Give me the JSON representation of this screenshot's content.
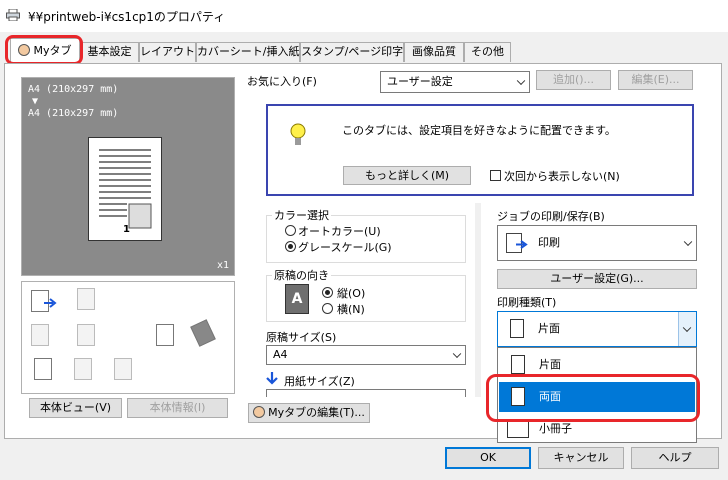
{
  "window": {
    "title": "¥¥printweb-i¥cs1cp1のプロパティ"
  },
  "tabs": [
    {
      "label": "Myタブ",
      "active": true
    },
    {
      "label": "基本設定"
    },
    {
      "label": "レイアウト"
    },
    {
      "label": "カバーシート/挿入紙"
    },
    {
      "label": "スタンプ/ページ印字"
    },
    {
      "label": "画像品質"
    },
    {
      "label": "その他"
    }
  ],
  "preview": {
    "line1": "A4 (210x297 mm)",
    "arrow": "▼",
    "line2": "A4 (210x297 mm)",
    "page_number": "1",
    "copies": "x1"
  },
  "buttons": {
    "body_view": "本体ビュー(V)",
    "body_info": "本体情報(I)",
    "add": "追加()...",
    "edit": "編集(E)...",
    "more": "もっと詳しく(M)",
    "user_settings": "ユーザー設定(G)...",
    "edit_mytab": "Myタブの編集(T)...",
    "ok": "OK",
    "cancel": "キャンセル",
    "help": "ヘルプ"
  },
  "favorites": {
    "label": "お気に入り(F)",
    "value": "ユーザー設定"
  },
  "info_box": {
    "message": "このタブには、設定項目を好きなように配置できます。",
    "dont_show": "次回から表示しない(N)"
  },
  "color": {
    "label": "カラー選択",
    "options": [
      {
        "label": "オートカラー(U)",
        "selected": false
      },
      {
        "label": "グレースケール(G)",
        "selected": true
      }
    ]
  },
  "orientation": {
    "label": "原稿の向き",
    "icon_letter": "A",
    "options": [
      {
        "label": "縦(O)",
        "selected": true
      },
      {
        "label": "横(N)",
        "selected": false
      }
    ]
  },
  "original_size": {
    "label": "原稿サイズ(S)",
    "value": "A4"
  },
  "paper_size": {
    "label": "用紙サイズ(Z)"
  },
  "job": {
    "label": "ジョブの印刷/保存(B)",
    "value": "印刷"
  },
  "print_type": {
    "label": "印刷種類(T)",
    "value": "片面",
    "options": [
      {
        "label": "片面",
        "selected": false
      },
      {
        "label": "両面",
        "selected": true
      },
      {
        "label": "小冊子",
        "selected": false
      }
    ]
  },
  "colors": {
    "accent": "#0078d7",
    "highlight_ring": "#e8262a",
    "info_border": "#3a45b0"
  }
}
